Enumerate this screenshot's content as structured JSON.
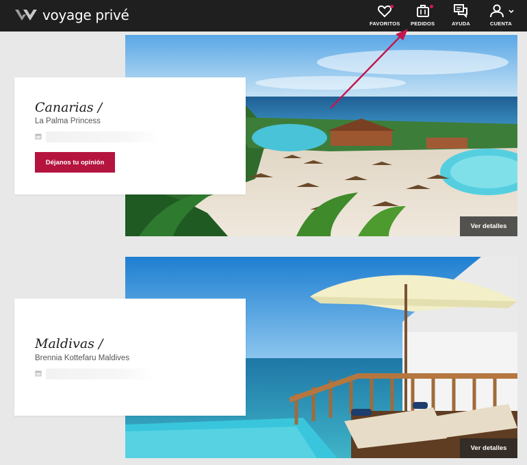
{
  "brand": {
    "name": "voyage privé"
  },
  "nav": [
    {
      "label": "FAVORITOS",
      "icon": "heart-icon",
      "notification": true
    },
    {
      "label": "PEDIDOS",
      "icon": "suitcase-icon",
      "notification": true
    },
    {
      "label": "AYUDA",
      "icon": "chat-icon",
      "notification": false
    },
    {
      "label": "CUENTA",
      "icon": "user-icon",
      "notification": false
    }
  ],
  "bookings": [
    {
      "destination": "Canarias /",
      "hotel": "La Palma Princess",
      "review_button": "Déjanos tu opinión",
      "details_button": "Ver detalles"
    },
    {
      "destination": "Maldivas /",
      "hotel": "Brennia Kottefaru Maldives",
      "details_button": "Ver detalles"
    }
  ],
  "colors": {
    "header": "#1f1f1f",
    "accent": "#b5143f",
    "background": "#e8e8e8"
  }
}
